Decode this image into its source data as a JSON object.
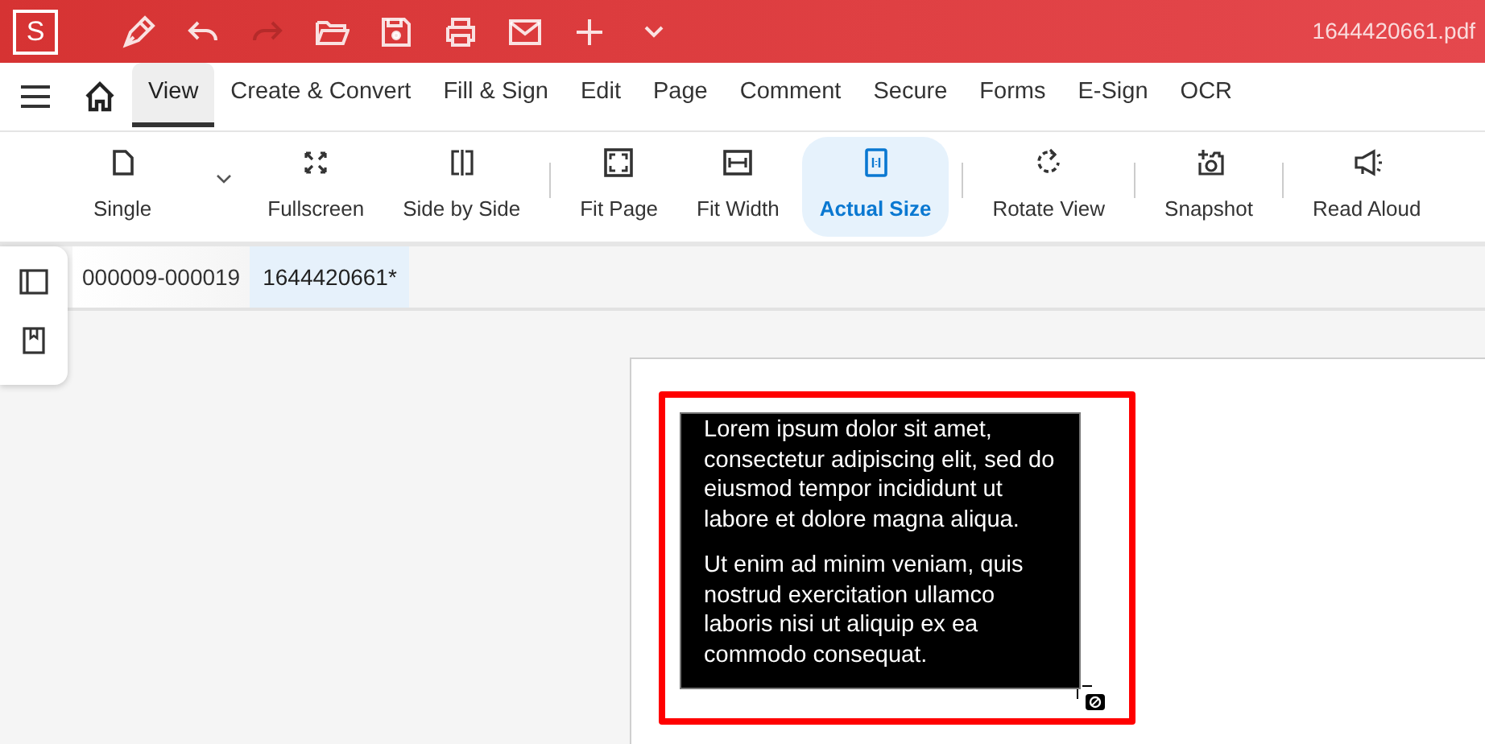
{
  "app": {
    "logo": "S",
    "file_name": "1644420661.pdf"
  },
  "quick_access": [
    {
      "disabled": false
    },
    {
      "disabled": false
    },
    {
      "disabled": true
    },
    {
      "disabled": false
    },
    {
      "disabled": false
    },
    {
      "disabled": false
    },
    {
      "disabled": false
    },
    {
      "disabled": false
    },
    {
      "disabled": false
    }
  ],
  "menu_tabs": [
    {
      "label": "View",
      "selected": true
    },
    {
      "label": "Create & Convert",
      "selected": false
    },
    {
      "label": "Fill & Sign",
      "selected": false
    },
    {
      "label": "Edit",
      "selected": false
    },
    {
      "label": "Page",
      "selected": false
    },
    {
      "label": "Comment",
      "selected": false
    },
    {
      "label": "Secure",
      "selected": false
    },
    {
      "label": "Forms",
      "selected": false
    },
    {
      "label": "E-Sign",
      "selected": false
    },
    {
      "label": "OCR",
      "selected": false
    }
  ],
  "toolbar": [
    {
      "kind": "button",
      "label": "Single",
      "selected": false
    },
    {
      "kind": "caret"
    },
    {
      "kind": "button",
      "label": "Fullscreen",
      "selected": false
    },
    {
      "kind": "button",
      "label": "Side by Side",
      "selected": false
    },
    {
      "kind": "separator"
    },
    {
      "kind": "button",
      "label": "Fit Page",
      "selected": false
    },
    {
      "kind": "button",
      "label": "Fit Width",
      "selected": false
    },
    {
      "kind": "button",
      "label": "Actual Size",
      "selected": true
    },
    {
      "kind": "separator"
    },
    {
      "kind": "button",
      "label": "Rotate View",
      "selected": false
    },
    {
      "kind": "separator"
    },
    {
      "kind": "button",
      "label": "Snapshot",
      "selected": false
    },
    {
      "kind": "separator"
    },
    {
      "kind": "button",
      "label": "Read Aloud",
      "selected": false
    }
  ],
  "doc_tabs": [
    {
      "label": "000009-000019",
      "selected": false
    },
    {
      "label": "1644420661*",
      "selected": true
    }
  ],
  "page": {
    "paragraphs": [
      "Lorem ipsum dolor sit amet, consectetur adipiscing elit, sed do eiusmod tempor incididunt ut labore et dolore magna aliqua.",
      "Ut enim ad minim veniam, quis nostrud exercitation ullamco laboris nisi ut aliquip ex ea commodo consequat."
    ]
  }
}
